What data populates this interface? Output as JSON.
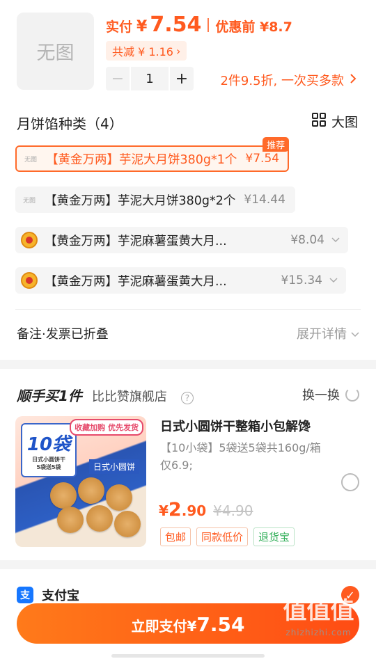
{
  "product": {
    "no_image_text": "无图",
    "pay_label": "实付",
    "currency": "¥",
    "pay_price": "7.54",
    "before_discount": "优惠前 ¥8.7",
    "discount_text": "共减 ¥ 1.16",
    "quantity": "1",
    "promo_text": "2件9.5折, 一次买多款"
  },
  "flavors": {
    "title": "月饼馅种类（4）",
    "big_view_label": "大图",
    "recommend_tag": "推荐",
    "thumb_text": "无图",
    "options": [
      {
        "name": "【黄金万两】芋泥大月饼380g*1个",
        "price": "¥7.54"
      },
      {
        "name": "【黄金万两】芋泥大月饼380g*2个",
        "price": "¥14.44"
      },
      {
        "name": "【黄金万两】芋泥麻薯蛋黄大月...",
        "price": "¥8.04"
      },
      {
        "name": "【黄金万两】芋泥麻薯蛋黄大月...",
        "price": "¥15.34"
      }
    ]
  },
  "notes": {
    "label": "备注·发票已折叠",
    "expand": "展开详情"
  },
  "addon": {
    "title": "顺手买1件",
    "shop": "比比赞旗舰店",
    "help_icon": "?",
    "swap_label": "换一换",
    "img_badge_num": "10袋",
    "img_badge_sub": "日式小圆饼干",
    "img_badge_sub2": "5袋送5袋",
    "img_corner": "收藏加购 优先发货",
    "img_box": "日式小圆饼",
    "name": "日式小圆饼干整箱小包解馋",
    "desc": "【10小袋】5袋送5袋共160g/箱 仅6.9;",
    "price_yen": "¥",
    "price_int": "2",
    "price_dec": ".90",
    "orig_price": "¥4.90",
    "chips": [
      "包邮",
      "同款低价",
      "退货宝"
    ]
  },
  "payment": {
    "method": "支付宝",
    "alipay_glyph": "支",
    "check_glyph": "✓",
    "button_prefix": "立即支付¥",
    "button_amount": "7.54"
  },
  "watermark": {
    "text": "值值值",
    "url": "zhizhizhi.com"
  },
  "colors": {
    "accent": "#ff5a1f",
    "green": "#2fae57",
    "alipay": "#1677ff"
  }
}
